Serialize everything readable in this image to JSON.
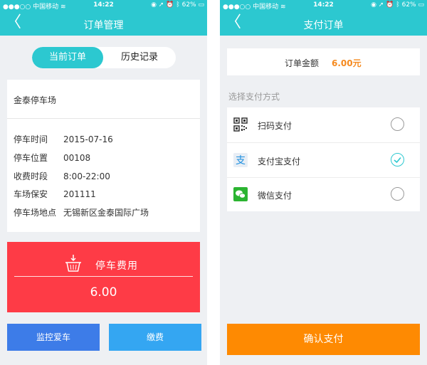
{
  "colors": {
    "primary": "#2cc8d0",
    "fee_panel": "#fe3b46",
    "monitor_button": "#3d7ce8",
    "pay_button": "#34a6f2",
    "confirm_button": "#fe8a02",
    "amount": "#f58a1f"
  },
  "status_bar": {
    "carrier": "中国移动",
    "time": "14:22",
    "battery": "62%"
  },
  "left": {
    "title": "订单管理",
    "tabs": [
      {
        "label": "当前订单",
        "active": true
      },
      {
        "label": "历史记录",
        "active": false
      }
    ],
    "parking_lot": "金泰停车场",
    "details": [
      {
        "label": "停车时间",
        "value": "2015-07-16"
      },
      {
        "label": "停车位置",
        "value": "00108"
      },
      {
        "label": "收费时段",
        "value": "8:00-22:00"
      },
      {
        "label": "车场保安",
        "value": "201111"
      },
      {
        "label": "停车场地点",
        "value": "无锡新区金泰国际广场"
      }
    ],
    "fee_label": "停车费用",
    "fee_amount": "6.00",
    "monitor_button": "监控爱车",
    "pay_button": "缴费"
  },
  "right": {
    "title": "支付订单",
    "amount_label": "订单金额",
    "amount_value": "6.00元",
    "method_heading": "选择支付方式",
    "methods": [
      {
        "label": "扫码支付",
        "icon": "qr-code-icon",
        "selected": false
      },
      {
        "label": "支付宝支付",
        "icon": "alipay-icon",
        "selected": true
      },
      {
        "label": "微信支付",
        "icon": "wechat-icon",
        "selected": false
      }
    ],
    "confirm_button": "确认支付"
  }
}
